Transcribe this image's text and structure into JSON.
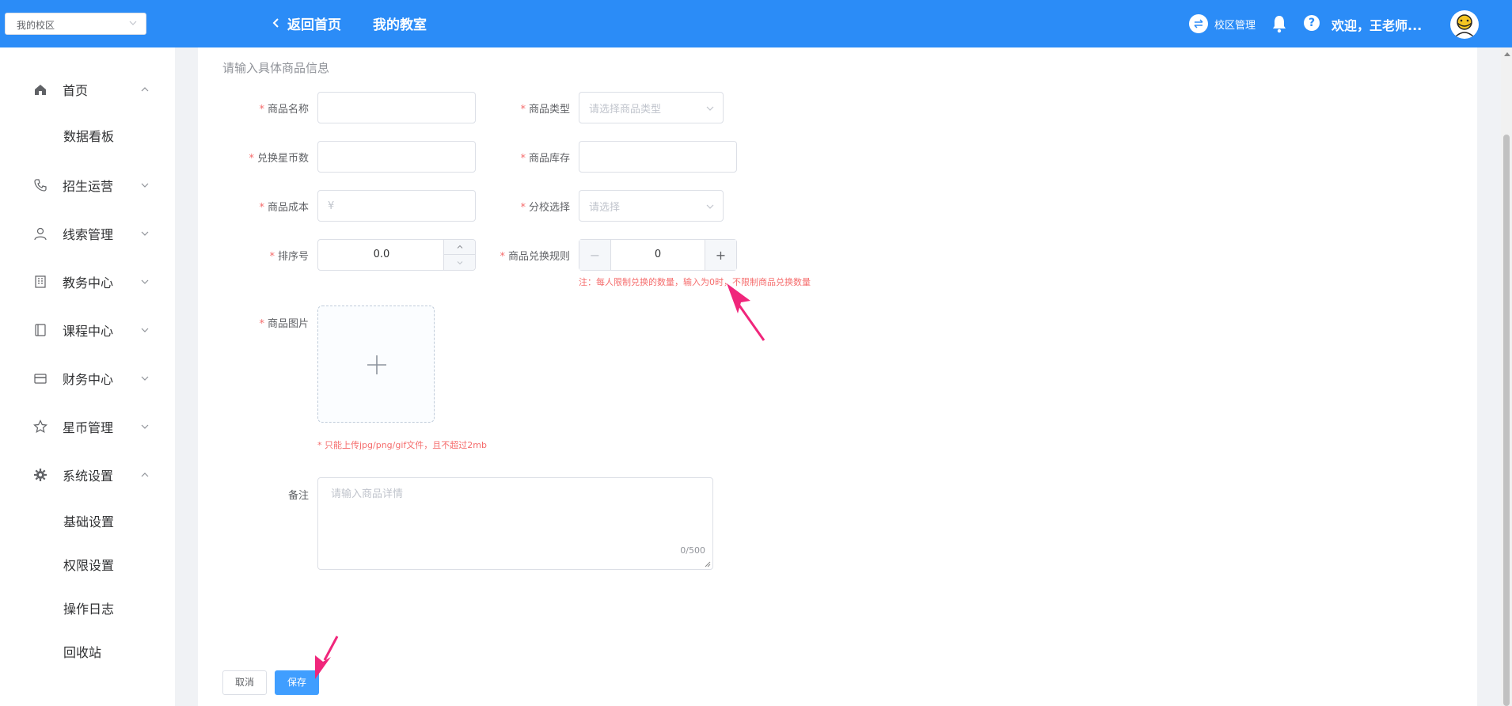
{
  "header": {
    "campus_select": "我的校区",
    "back_home": "返回首页",
    "my_classroom": "我的教室",
    "campus_manage": "校区管理",
    "welcome": "欢迎，王老师..."
  },
  "sidebar": {
    "items": [
      {
        "label": "首页",
        "icon": "home-icon"
      },
      {
        "label": "数据看板"
      },
      {
        "label": "招生运营",
        "icon": "phone-icon"
      },
      {
        "label": "线索管理",
        "icon": "user-icon"
      },
      {
        "label": "教务中心",
        "icon": "building-icon"
      },
      {
        "label": "课程中心",
        "icon": "book-icon"
      },
      {
        "label": "财务中心",
        "icon": "card-icon"
      },
      {
        "label": "星币管理",
        "icon": "star-icon"
      },
      {
        "label": "系统设置",
        "icon": "gear-icon"
      },
      {
        "label": "基础设置"
      },
      {
        "label": "权限设置"
      },
      {
        "label": "操作日志"
      },
      {
        "label": "回收站"
      }
    ]
  },
  "form": {
    "section_title": "请输入具体商品信息",
    "required_mark": "*",
    "name_label": "商品名称",
    "type_label": "商品类型",
    "type_placeholder": "请选择商品类型",
    "coins_label": "兑换星币数",
    "stock_label": "商品库存",
    "cost_label": "商品成本",
    "cost_prefix": "¥",
    "branch_label": "分校选择",
    "branch_placeholder": "请选择",
    "sort_label": "排序号",
    "sort_value": "0.0",
    "rule_label": "商品兑换规则",
    "rule_value": "0",
    "rule_note": "注：每人限制兑换的数量，输入为0时，不限制商品兑换数量",
    "image_label": "商品图片",
    "image_note": "* 只能上传jpg/png/gif文件，且不超过2mb",
    "remark_label": "备注",
    "remark_placeholder": "请输入商品详情",
    "remark_counter": "0/500",
    "cancel": "取消",
    "save": "保存"
  },
  "colors": {
    "header": "#2b8cf7",
    "primary": "#409eff",
    "danger": "#f56c6c",
    "annotation": "#f0267b"
  }
}
